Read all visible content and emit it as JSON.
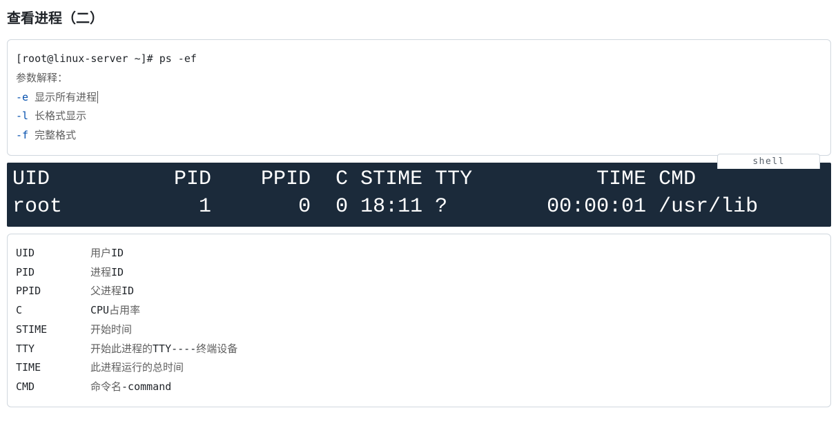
{
  "heading": "查看进程（二）",
  "block1": {
    "line1": "[root@linux-server ~]# ps -ef",
    "line2": "参数解释：",
    "flagE": "-e",
    "flagEDesc": "显示所有进程",
    "flagL": "-l",
    "flagLDesc": "长格式显示",
    "flagF": "-f",
    "flagFDesc": "完整格式"
  },
  "shellLabel": "shell",
  "terminal": {
    "header": "UID          PID    PPID  C STIME TTY          TIME CMD",
    "row": "root           1       0  0 18:11 ?        00:00:01 /usr/lib"
  },
  "desc": [
    {
      "key": "UID",
      "val_pre": "用户",
      "val_mono": "ID",
      "val_post": ""
    },
    {
      "key": "PID",
      "val_pre": "进程",
      "val_mono": "ID",
      "val_post": ""
    },
    {
      "key": "PPID",
      "val_pre": "父进程",
      "val_mono": "ID",
      "val_post": ""
    },
    {
      "key": "C",
      "val_pre": "",
      "val_mono": "CPU",
      "val_post": "占用率"
    },
    {
      "key": "STIME",
      "val_pre": "开始时间",
      "val_mono": "",
      "val_post": ""
    },
    {
      "key": "TTY",
      "val_pre": "开始此进程的",
      "val_mono": "TTY----",
      "val_post": "终端设备"
    },
    {
      "key": "TIME",
      "val_pre": "此进程运行的总时间",
      "val_mono": "",
      "val_post": ""
    },
    {
      "key": "CMD",
      "val_pre": "命令名",
      "val_mono": "-command",
      "val_post": ""
    }
  ]
}
